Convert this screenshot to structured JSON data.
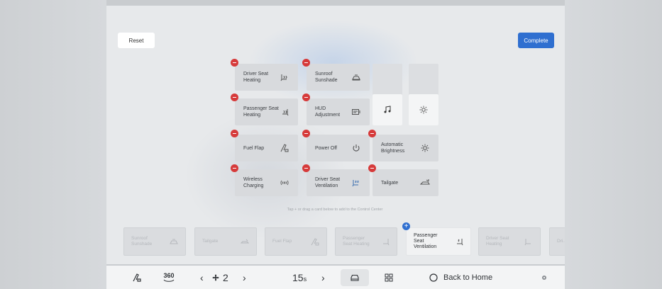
{
  "header": {
    "reset_label": "Reset",
    "complete_label": "Complete"
  },
  "colors": {
    "accent": "#2f6fd0",
    "remove": "#d63a3a"
  },
  "selected_tiles": [
    {
      "label": "Driver Seat Heating",
      "icon": "seat-heat-icon"
    },
    {
      "label": "Sunroof Sunshade",
      "icon": "sunroof-icon"
    },
    {
      "label": "Passenger Seat Heating",
      "icon": "seat-heat-icon"
    },
    {
      "label": "HUD Adjustment",
      "icon": "hud-icon"
    },
    {
      "label": "Fuel Flap",
      "icon": "fuel-icon"
    },
    {
      "label": "Power Off",
      "icon": "power-icon"
    },
    {
      "label": "Automatic Brightness",
      "icon": "brightness-icon"
    },
    {
      "label": "Wireless Charging",
      "icon": "wireless-icon"
    },
    {
      "label": "Driver Seat Ventilation",
      "icon": "seat-vent-icon"
    },
    {
      "label": "Tailgate",
      "icon": "tailgate-icon"
    }
  ],
  "fixed_tiles": {
    "music_icon": "music-icon",
    "brightness_icon": "sun-icon"
  },
  "hint": "Tap + or drag a card below to add to the Control Center",
  "available_tiles": [
    {
      "label": "Sunroof Sunshade"
    },
    {
      "label": "Tailgate"
    },
    {
      "label": "Fuel Flap"
    },
    {
      "label": "Passenger Seat Heating"
    },
    {
      "label": "Passenger Seat Ventilation"
    },
    {
      "label": "Driver Seat Heating"
    },
    {
      "label": "Dri..."
    }
  ],
  "bottom_bar": {
    "fan_speed": "2",
    "temperature": "15",
    "temp_unit": "s",
    "back_home_label": "Back to Home",
    "view_360_label": "360"
  }
}
